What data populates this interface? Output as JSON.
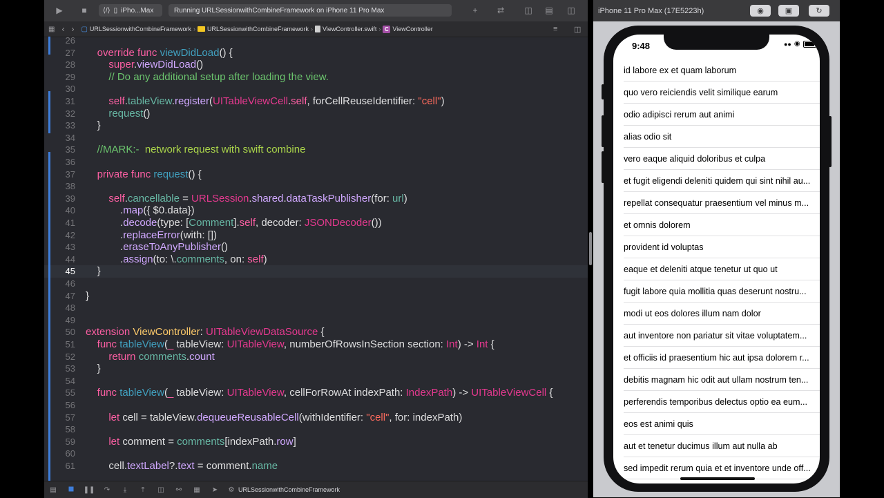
{
  "toolbar": {
    "scheme_label": "iPho...Max",
    "activity_text": "Running URLSessionwithCombineFramework on iPhone 11 Pro Max"
  },
  "jumpbar": {
    "crumbs": [
      "URLSessionwithCombineFramework",
      "URLSessionwithCombineFramework",
      "ViewController.swift",
      "ViewController"
    ]
  },
  "editor": {
    "current_line": 45,
    "lines": [
      {
        "n": "26",
        "html": ""
      },
      {
        "n": "27",
        "html": "    <span class='kw'>override</span> <span class='kw'>func</span> <span class='fn'>viewDidLoad</span>() {"
      },
      {
        "n": "28",
        "html": "        <span class='kw'>super</span>.<span class='ty'>viewDidLoad</span>()"
      },
      {
        "n": "29",
        "html": "        <span class='cm'>// Do any additional setup after loading the view.</span>"
      },
      {
        "n": "30",
        "html": ""
      },
      {
        "n": "31",
        "html": "        <span class='kw'>self</span>.<span class='proj'>tableView</span>.<span class='ty'>register</span>(<span class='cls'>UITableViewCell</span>.<span class='kw'>self</span>, forCellReuseIdentifier: <span class='str'>\"cell\"</span>)"
      },
      {
        "n": "32",
        "html": "        <span class='proj'>request</span>()"
      },
      {
        "n": "33",
        "html": "    }"
      },
      {
        "n": "34",
        "html": ""
      },
      {
        "n": "35",
        "html": "    <span class='cm'>//MARK:-  </span><span class='mark'>network request with swift combine</span>"
      },
      {
        "n": "36",
        "html": ""
      },
      {
        "n": "37",
        "html": "    <span class='kw'>private</span> <span class='kw'>func</span> <span class='fn'>request</span>() {"
      },
      {
        "n": "38",
        "html": ""
      },
      {
        "n": "39",
        "html": "        <span class='kw'>self</span>.<span class='proj'>cancellable</span> = <span class='cls'>URLSession</span>.<span class='ty'>shared</span>.<span class='ty'>dataTaskPublisher</span>(for: <span class='proj'>url</span>)"
      },
      {
        "n": "40",
        "html": "            .<span class='ty'>map</span>({ $0.data})"
      },
      {
        "n": "41",
        "html": "            .<span class='ty'>decode</span>(type: [<span class='proj'>Comment</span>].<span class='kw'>self</span>, decoder: <span class='cls'>JSONDecoder</span>())"
      },
      {
        "n": "42",
        "html": "            .<span class='ty'>replaceError</span>(with: [])"
      },
      {
        "n": "43",
        "html": "            .<span class='ty'>eraseToAnyPublisher</span>()"
      },
      {
        "n": "44",
        "html": "            .<span class='ty'>assign</span>(to: \\.<span class='proj'>comments</span>, on: <span class='kw'>self</span>)"
      },
      {
        "n": "45",
        "html": "    }"
      },
      {
        "n": "46",
        "html": ""
      },
      {
        "n": "47",
        "html": "}"
      },
      {
        "n": "48",
        "html": ""
      },
      {
        "n": "49",
        "html": ""
      },
      {
        "n": "50",
        "html": "<span class='kw'>extension</span> <span class='tyname'>ViewController</span>: <span class='cls'>UITableViewDataSource</span> {"
      },
      {
        "n": "51",
        "html": "    <span class='kw'>func</span> <span class='fn'>tableView</span>(<span class='kw'>_</span> tableView: <span class='cls'>UITableView</span>, numberOfRowsInSection section: <span class='cls'>Int</span>) -> <span class='cls'>Int</span> {"
      },
      {
        "n": "52",
        "html": "        <span class='kw'>return</span> <span class='proj'>comments</span>.<span class='ty'>count</span>"
      },
      {
        "n": "53",
        "html": "    }"
      },
      {
        "n": "54",
        "html": ""
      },
      {
        "n": "55",
        "html": "    <span class='kw'>func</span> <span class='fn'>tableView</span>(<span class='kw'>_</span> tableView: <span class='cls'>UITableView</span>, cellForRowAt indexPath: <span class='cls'>IndexPath</span>) -> <span class='cls'>UITableViewCell</span> {"
      },
      {
        "n": "56",
        "html": ""
      },
      {
        "n": "57",
        "html": "        <span class='kw'>let</span> cell = tableView.<span class='ty'>dequeueReusableCell</span>(withIdentifier: <span class='str'>\"cell\"</span>, for: indexPath)"
      },
      {
        "n": "58",
        "html": ""
      },
      {
        "n": "59",
        "html": "        <span class='kw'>let</span> comment = <span class='proj'>comments</span>[indexPath.<span class='ty'>row</span>]"
      },
      {
        "n": "60",
        "html": ""
      },
      {
        "n": "61",
        "html": "        cell.<span class='ty'>textLabel</span>?.<span class='ty'>text</span> = comment.<span class='proj'>name</span>"
      }
    ]
  },
  "debugbar": {
    "target_label": "URLSessionwithCombineFramework"
  },
  "simulator": {
    "title": "iPhone 11 Pro Max (17E5223h)",
    "time": "9:48",
    "rows": [
      "id labore ex et quam laborum",
      "quo vero reiciendis velit similique earum",
      "odio adipisci rerum aut animi",
      "alias odio sit",
      "vero eaque aliquid doloribus et culpa",
      "et fugit eligendi deleniti quidem qui sint nihil au...",
      "repellat consequatur praesentium vel minus m...",
      "et omnis dolorem",
      "provident id voluptas",
      "eaque et deleniti atque tenetur ut quo ut",
      "fugit labore quia mollitia quas deserunt nostru...",
      "modi ut eos dolores illum nam dolor",
      "aut inventore non pariatur sit vitae voluptatem...",
      "et officiis id praesentium hic aut ipsa dolorem r...",
      "debitis magnam hic odit aut ullam nostrum ten...",
      "perferendis temporibus delectus optio ea eum...",
      "eos est animi quis",
      "aut et tenetur ducimus illum aut nulla ab",
      "sed impedit rerum quia et et inventore unde off..."
    ]
  }
}
